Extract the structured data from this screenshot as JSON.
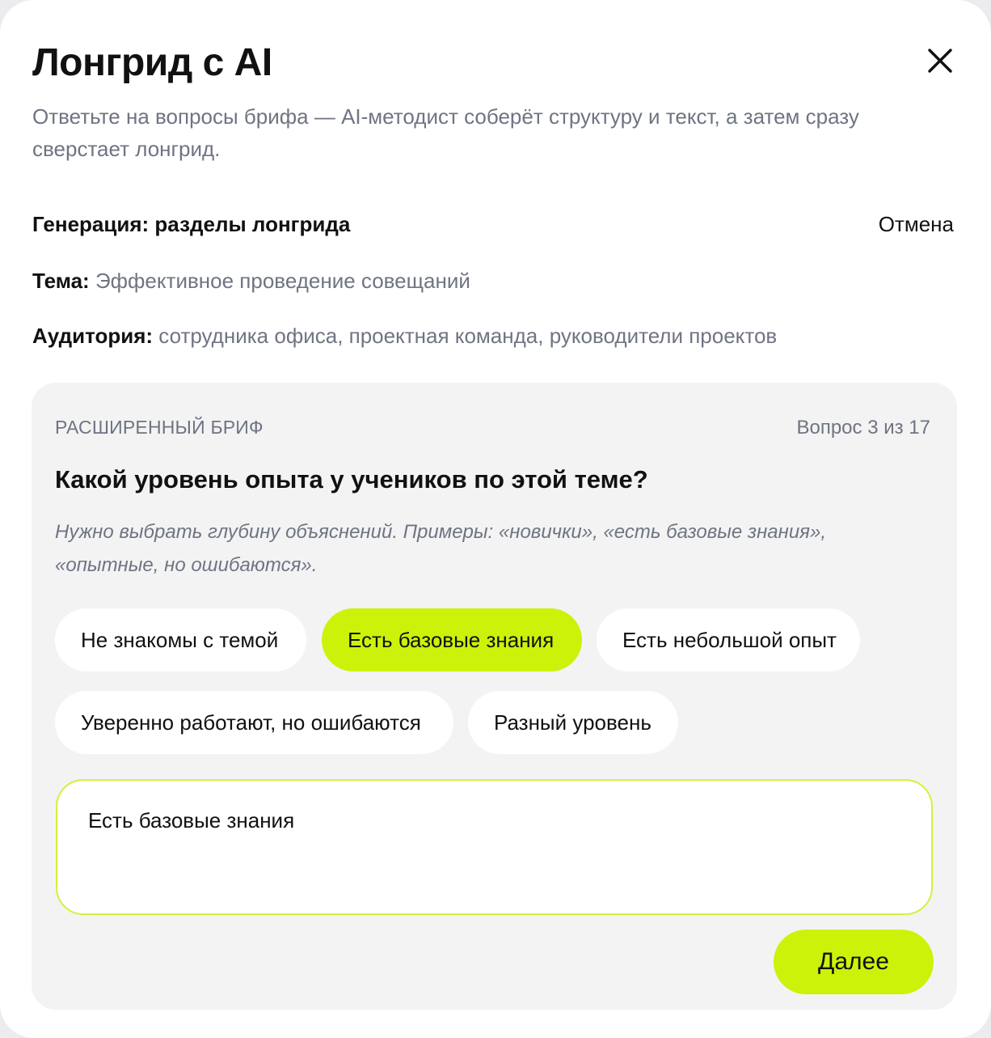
{
  "header": {
    "title": "Лонгрид с AI",
    "subtitle": "Ответьте на вопросы брифа — AI-методист соберёт структуру и текст, а затем сразу сверстает лонгрид.",
    "close_icon": "close-icon"
  },
  "generation": {
    "label": "Генерация: разделы лонгрида",
    "cancel_label": "Отмена"
  },
  "topic": {
    "label": "Тема:",
    "value": "Эффективное проведение совещаний"
  },
  "audience": {
    "label": "Аудитория:",
    "value": "сотрудника офиса, проектная команда, руководители проектов"
  },
  "brief": {
    "section_label": "РАСШИРЕННЫЙ БРИФ",
    "counter": "Вопрос 3 из 17",
    "question": "Какой уровень опыта у учеников по этой теме?",
    "hint": "Нужно выбрать глубину объяснений. Примеры: «новички», «есть базовые знания», «опытные, но ошибаются».",
    "options": [
      {
        "label": "Не знакомы с темой",
        "selected": false
      },
      {
        "label": "Есть базовые знания",
        "selected": true
      },
      {
        "label": "Есть небольшой опыт",
        "selected": false
      },
      {
        "label": "Уверенно работают, но ошибаются",
        "selected": false
      },
      {
        "label": "Разный уровень",
        "selected": false
      }
    ],
    "answer_value": "Есть базовые знания",
    "next_label": "Далее"
  },
  "colors": {
    "accent": "#ccf20a",
    "answer_border": "#d2f23a",
    "muted_text": "#6f7482",
    "card_background": "#f3f3f4",
    "page_background": "#ffffff"
  }
}
